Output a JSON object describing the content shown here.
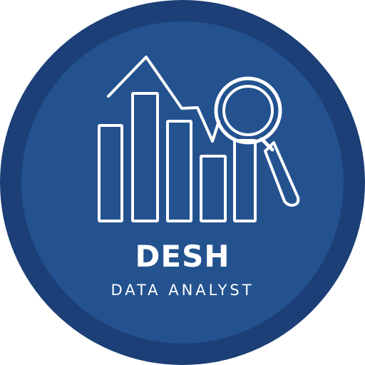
{
  "logo": {
    "name": "DESH",
    "tagline": "DATA ANALYST",
    "icon": "bar-chart-with-trend-line-and-magnifying-glass-icon"
  },
  "colors": {
    "outer_ring": "#1b3f76",
    "inner_disc": "#23528f",
    "icon_stroke": "#ffffff",
    "text": "#ffffff"
  }
}
